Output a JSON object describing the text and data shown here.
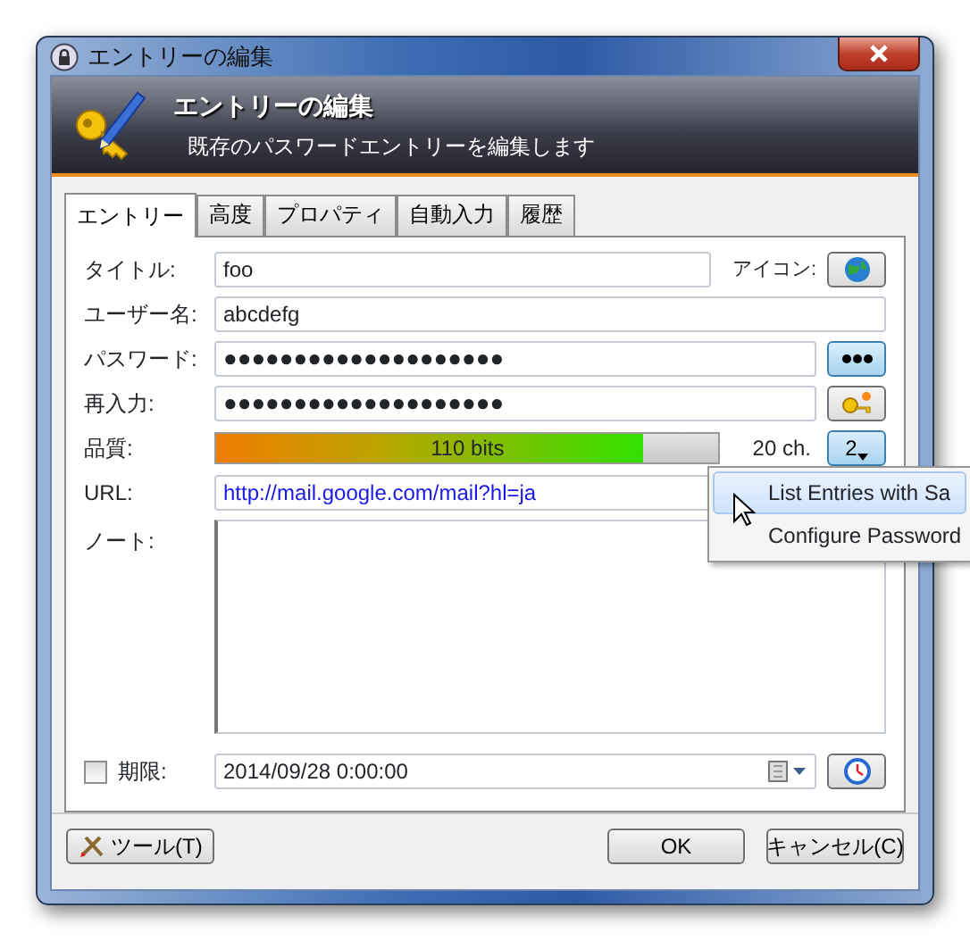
{
  "window": {
    "title": "エントリーの編集"
  },
  "banner": {
    "title": "エントリーの編集",
    "subtitle": "既存のパスワードエントリーを編集します"
  },
  "tabs": [
    {
      "label": "エントリー",
      "selected": true
    },
    {
      "label": "高度",
      "selected": false
    },
    {
      "label": "プロパティ",
      "selected": false
    },
    {
      "label": "自動入力",
      "selected": false
    },
    {
      "label": "履歴",
      "selected": false
    }
  ],
  "form": {
    "title": {
      "label": "タイトル:",
      "value": "foo"
    },
    "icon_label": "アイコン:",
    "username": {
      "label": "ユーザー名:",
      "value": "abcdefg"
    },
    "password": {
      "label": "パスワード:",
      "value": "●●●●●●●●●●●●●●●●●●●●"
    },
    "repeat": {
      "label": "再入力:",
      "value": "●●●●●●●●●●●●●●●●●●●●"
    },
    "quality": {
      "label": "品質:",
      "reading": "110 bits",
      "level": 0.85,
      "length": "20 ch.",
      "button": "2"
    },
    "url": {
      "label": "URL:",
      "value": "http://mail.google.com/mail?hl=ja"
    },
    "notes": {
      "label": "ノート:"
    },
    "expiry": {
      "label": "期限:",
      "checked": false,
      "value": "2014/09/28   0:00:00"
    }
  },
  "menu": {
    "items": [
      {
        "label": "List Entries with Sa",
        "selected": true
      },
      {
        "label": "Configure Password",
        "selected": false
      }
    ]
  },
  "buttons": {
    "tools": "ツール(T)",
    "ok": "OK",
    "cancel": "キャンセル(C)"
  }
}
